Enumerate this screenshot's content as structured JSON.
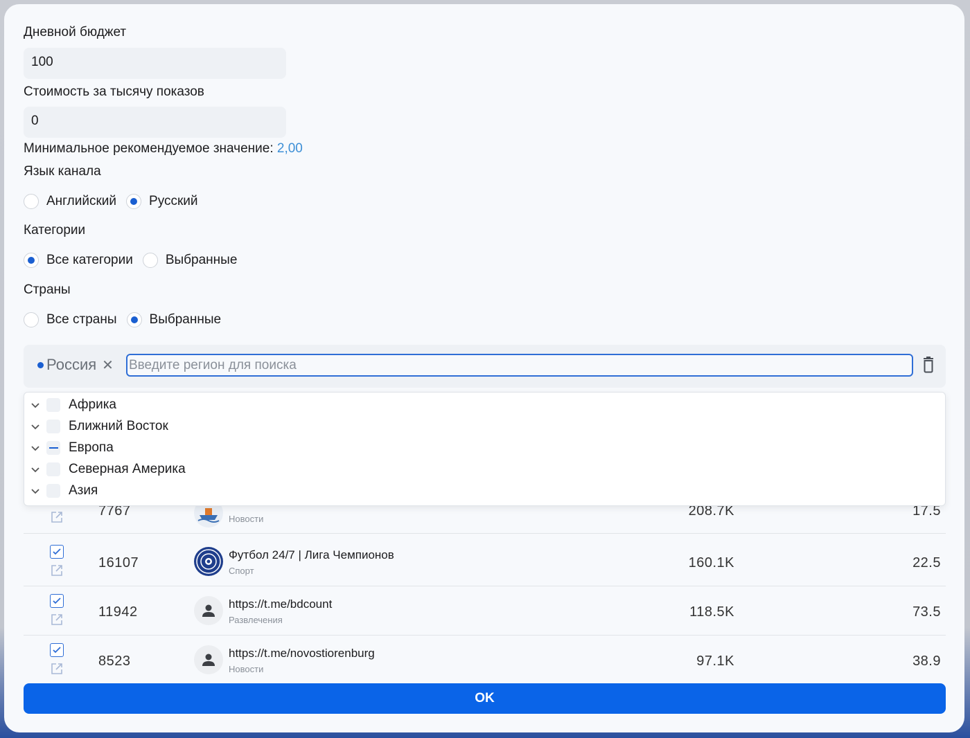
{
  "form": {
    "daily_budget_label": "Дневной бюджет",
    "daily_budget_value": "100",
    "cpm_label": "Стоимость за тысячу показов",
    "cpm_value": "0",
    "min_hint_text": "Минимальное рекомендуемое значение: ",
    "min_hint_value": "2,00",
    "language_label": "Язык канала",
    "language_options": [
      {
        "label": "Английский",
        "selected": false
      },
      {
        "label": "Русский",
        "selected": true
      }
    ],
    "categories_label": "Категории",
    "category_options": [
      {
        "label": "Все категории",
        "selected": true
      },
      {
        "label": "Выбранные",
        "selected": false
      }
    ],
    "countries_label": "Страны",
    "country_options": [
      {
        "label": "Все страны",
        "selected": false
      },
      {
        "label": "Выбранные",
        "selected": true
      }
    ]
  },
  "countries": {
    "selected_chip": "Россия",
    "search_placeholder": "Введите регион для поиска",
    "regions": [
      {
        "label": "Африка",
        "state": "unchecked"
      },
      {
        "label": "Ближний Восток",
        "state": "unchecked"
      },
      {
        "label": "Европа",
        "state": "partial"
      },
      {
        "label": "Северная Америка",
        "state": "unchecked"
      },
      {
        "label": "Азия",
        "state": "unchecked"
      }
    ]
  },
  "table": {
    "rows": [
      {
        "id": "7767",
        "name": "",
        "category": "Новости",
        "subscribers": "208.7K",
        "cpm": "17.5",
        "checked": true,
        "avatar": "boat"
      },
      {
        "id": "16107",
        "name": "Футбол 24/7 | Лига Чемпионов",
        "category": "Спорт",
        "subscribers": "160.1K",
        "cpm": "22.5",
        "checked": true,
        "avatar": "football"
      },
      {
        "id": "11942",
        "name": "https://t.me/bdcount",
        "category": "Развлечения",
        "subscribers": "118.5K",
        "cpm": "73.5",
        "checked": true,
        "avatar": "person-icon"
      },
      {
        "id": "8523",
        "name": "https://t.me/novostiorenburg",
        "category": "Новости",
        "subscribers": "97.1K",
        "cpm": "38.9",
        "checked": true,
        "avatar": "person-icon"
      }
    ]
  },
  "ok_button": "OK",
  "colors": {
    "accent": "#0a64e8",
    "link": "#3d8fd6",
    "field_bg": "#eef1f5"
  }
}
